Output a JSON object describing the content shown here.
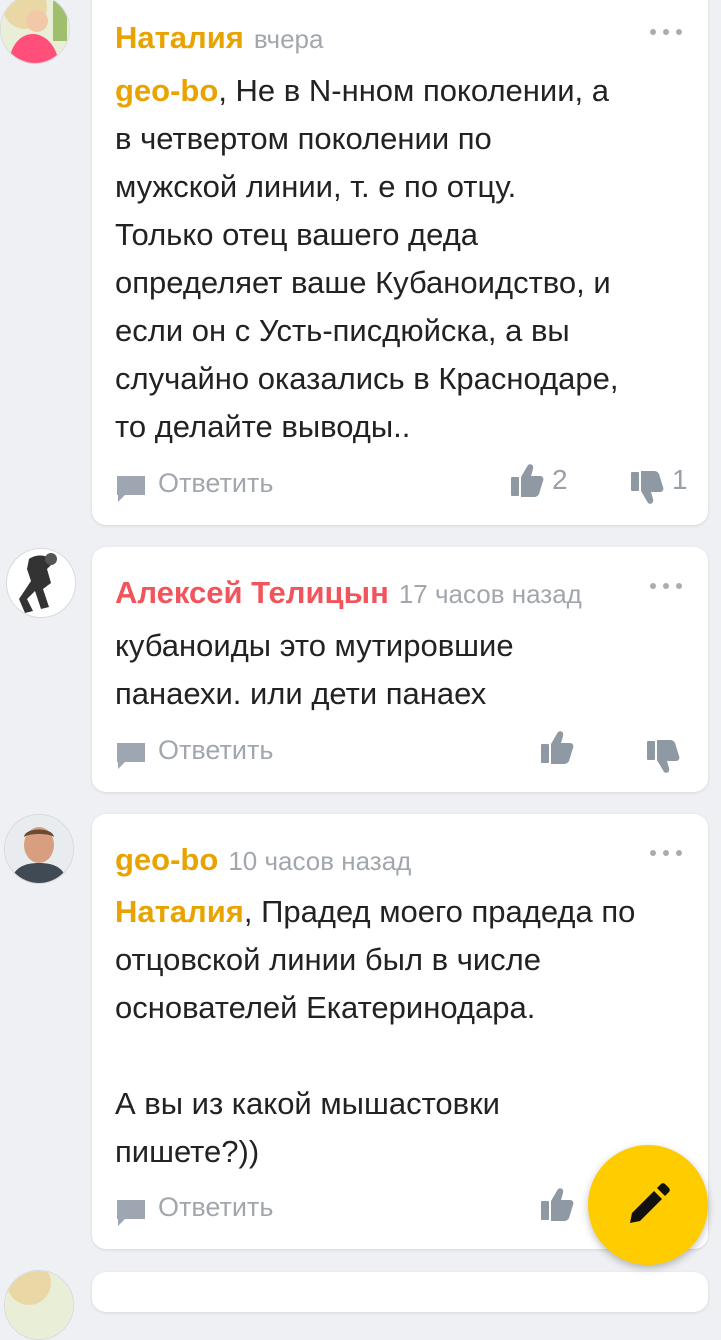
{
  "colors": {
    "author_yellow": "#e9a300",
    "author_red": "#f2545b",
    "meta_gray": "#a2a7ae",
    "icon_gray": "#8f99a3",
    "fab_yellow": "#ffcc00",
    "background": "#eef0f3"
  },
  "comments": [
    {
      "author": "Наталия",
      "time": "вчера",
      "mention": "geo-bo",
      "lines": [
        ", Не в N-нном поколении, а",
        "в четвертом поколении по",
        "мужской линии, т. е по отцу.",
        "Только отец вашего деда",
        "определяет ваше Кубаноидство, и",
        "если он с Усть-писдюйска, а вы",
        "случайно оказались в Краснодаре,",
        "то делайте выводы.."
      ],
      "reply_label": "Ответить",
      "likes": "2",
      "dislikes": "1",
      "more_icon": "more-dots-icon"
    },
    {
      "author": "Алексей Телицын",
      "time": "17 часов назад",
      "lines": [
        "кубаноиды это мутировшие",
        "панаехи. или дети панаех"
      ],
      "reply_label": "Ответить",
      "more_icon": "more-dots-icon"
    },
    {
      "author": "geo-bo",
      "time": "10 часов назад",
      "mention": "Наталия",
      "lines": [
        ", Прадед моего прадеда по",
        "отцовской линии был в числе",
        "основателей Екатеринодара.",
        "",
        "А вы из какой мышастовки",
        "пишете?))"
      ],
      "reply_label": "Ответить",
      "more_icon": "more-dots-icon"
    }
  ],
  "fab": {
    "icon": "pencil-icon"
  }
}
